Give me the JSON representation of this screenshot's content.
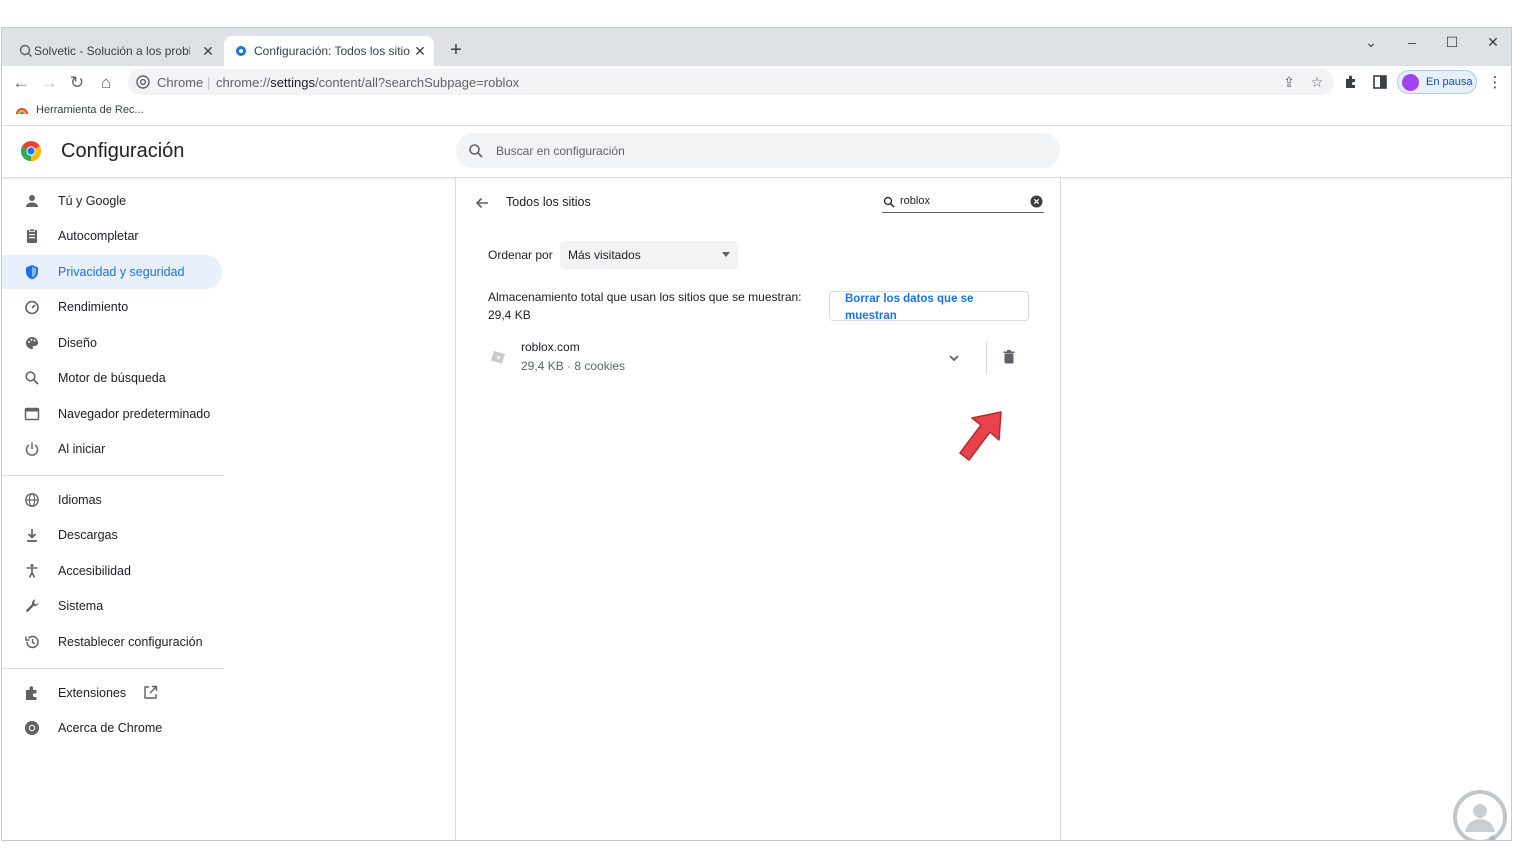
{
  "browser": {
    "tabs": [
      {
        "title": "Solvetic - Solución a los problem",
        "active": false
      },
      {
        "title": "Configuración: Todos los sitios",
        "active": true
      }
    ],
    "omnibox": {
      "site_label": "Chrome",
      "url_prefix": "chrome://",
      "url_host": "settings",
      "url_path": "/content/all?searchSubpage=roblox"
    },
    "profile_label": "En pausa",
    "bookmark": "Herramienta de Rec..."
  },
  "settings": {
    "title": "Configuración",
    "search_placeholder": "Buscar en configuración"
  },
  "sidebar": {
    "items": [
      {
        "label": "Tú y Google",
        "icon": "person-icon"
      },
      {
        "label": "Autocompletar",
        "icon": "clipboard-icon"
      },
      {
        "label": "Privacidad y seguridad",
        "icon": "shield-icon",
        "active": true
      },
      {
        "label": "Rendimiento",
        "icon": "speedometer-icon"
      },
      {
        "label": "Diseño",
        "icon": "palette-icon"
      },
      {
        "label": "Motor de búsqueda",
        "icon": "search-icon"
      },
      {
        "label": "Navegador predeterminado",
        "icon": "browser-icon"
      },
      {
        "label": "Al iniciar",
        "icon": "power-icon"
      },
      {
        "label": "Idiomas",
        "icon": "globe-icon"
      },
      {
        "label": "Descargas",
        "icon": "download-icon"
      },
      {
        "label": "Accesibilidad",
        "icon": "accessibility-icon"
      },
      {
        "label": "Sistema",
        "icon": "wrench-icon"
      },
      {
        "label": "Restablecer configuración",
        "icon": "restore-icon"
      },
      {
        "label": "Extensiones",
        "icon": "puzzle-icon"
      },
      {
        "label": "Acerca de Chrome",
        "icon": "chrome-icon"
      }
    ]
  },
  "main": {
    "subpage_title": "Todos los sitios",
    "filter_value": "roblox",
    "sort_label": "Ordenar por",
    "sort_value": "Más visitados",
    "storage_text": "Almacenamiento total que usan los sitios que se muestran: 29,4 KB",
    "clear_button": "Borrar los datos que se muestran",
    "site": {
      "name": "roblox.com",
      "details": "29,4 KB · 8 cookies"
    }
  },
  "colors": {
    "accent": "#1a73e8",
    "active_nav_bg": "#e8f0fe",
    "annotation_arrow": "#e8434a"
  }
}
